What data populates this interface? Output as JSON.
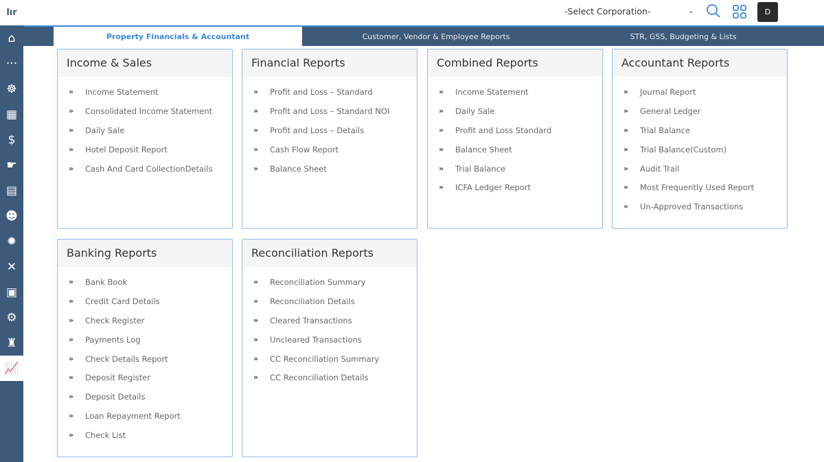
{
  "header": {
    "corporation_select": "-Select Corporation-",
    "avatar": "D"
  },
  "sidebar": {
    "icons": [
      "home-icon",
      "more-icon",
      "user-settings-icon",
      "building-icon",
      "finance-icon",
      "hand-money-icon",
      "invoice-icon",
      "user-dollar-icon",
      "idea-icon",
      "tools-icon",
      "document-icon",
      "gear-people-icon",
      "money-bag-icon",
      "chart-growth-icon"
    ]
  },
  "tabs": [
    {
      "label": "Property Financials & Accountant"
    },
    {
      "label": "Customer, Vendor & Employee Reports"
    },
    {
      "label": "STR, GSS, Budgeting & Lists"
    }
  ],
  "cards": [
    {
      "title": "Income & Sales",
      "items": [
        "Income Statement",
        "Consolidated Income Statement",
        "Daily Sale",
        "Hotel Deposit Report",
        "Cash And Card CollectionDetails"
      ]
    },
    {
      "title": "Financial Reports",
      "items": [
        "Profit and Loss – Standard",
        "Profit and Loss – Standard NOI",
        "Profit and Loss – Details",
        "Cash Flow Report",
        "Balance Sheet"
      ]
    },
    {
      "title": "Combined Reports",
      "items": [
        "Income Statement",
        "Daily Sale",
        "Profit and Loss Standard",
        "Balance Sheet",
        "Trial Balance",
        "ICFA Ledger Report"
      ]
    },
    {
      "title": "Accountant Reports",
      "items": [
        "Journal Report",
        "General Ledger",
        "Trial Balance",
        "Trial Balance(Custom)",
        "Audit Trail",
        "Most Frequently Used Report",
        "Un-Approved Transactions"
      ]
    },
    {
      "title": "Banking Reports",
      "items": [
        "Bank Book",
        "Credit Card Details",
        "Check Register",
        "Payments Log",
        "Check Details Report",
        "Deposit Register",
        "Deposit Details",
        "Loan Repayment Report",
        "Check List"
      ]
    },
    {
      "title": "Reconciliation Reports",
      "items": [
        "Reconciliation Summary",
        "Reconciliation Details",
        "Cleared Transactions",
        "Uncleared Transactions",
        "CC Reconciliation Summary",
        "CC Reconciliation Details"
      ]
    }
  ]
}
